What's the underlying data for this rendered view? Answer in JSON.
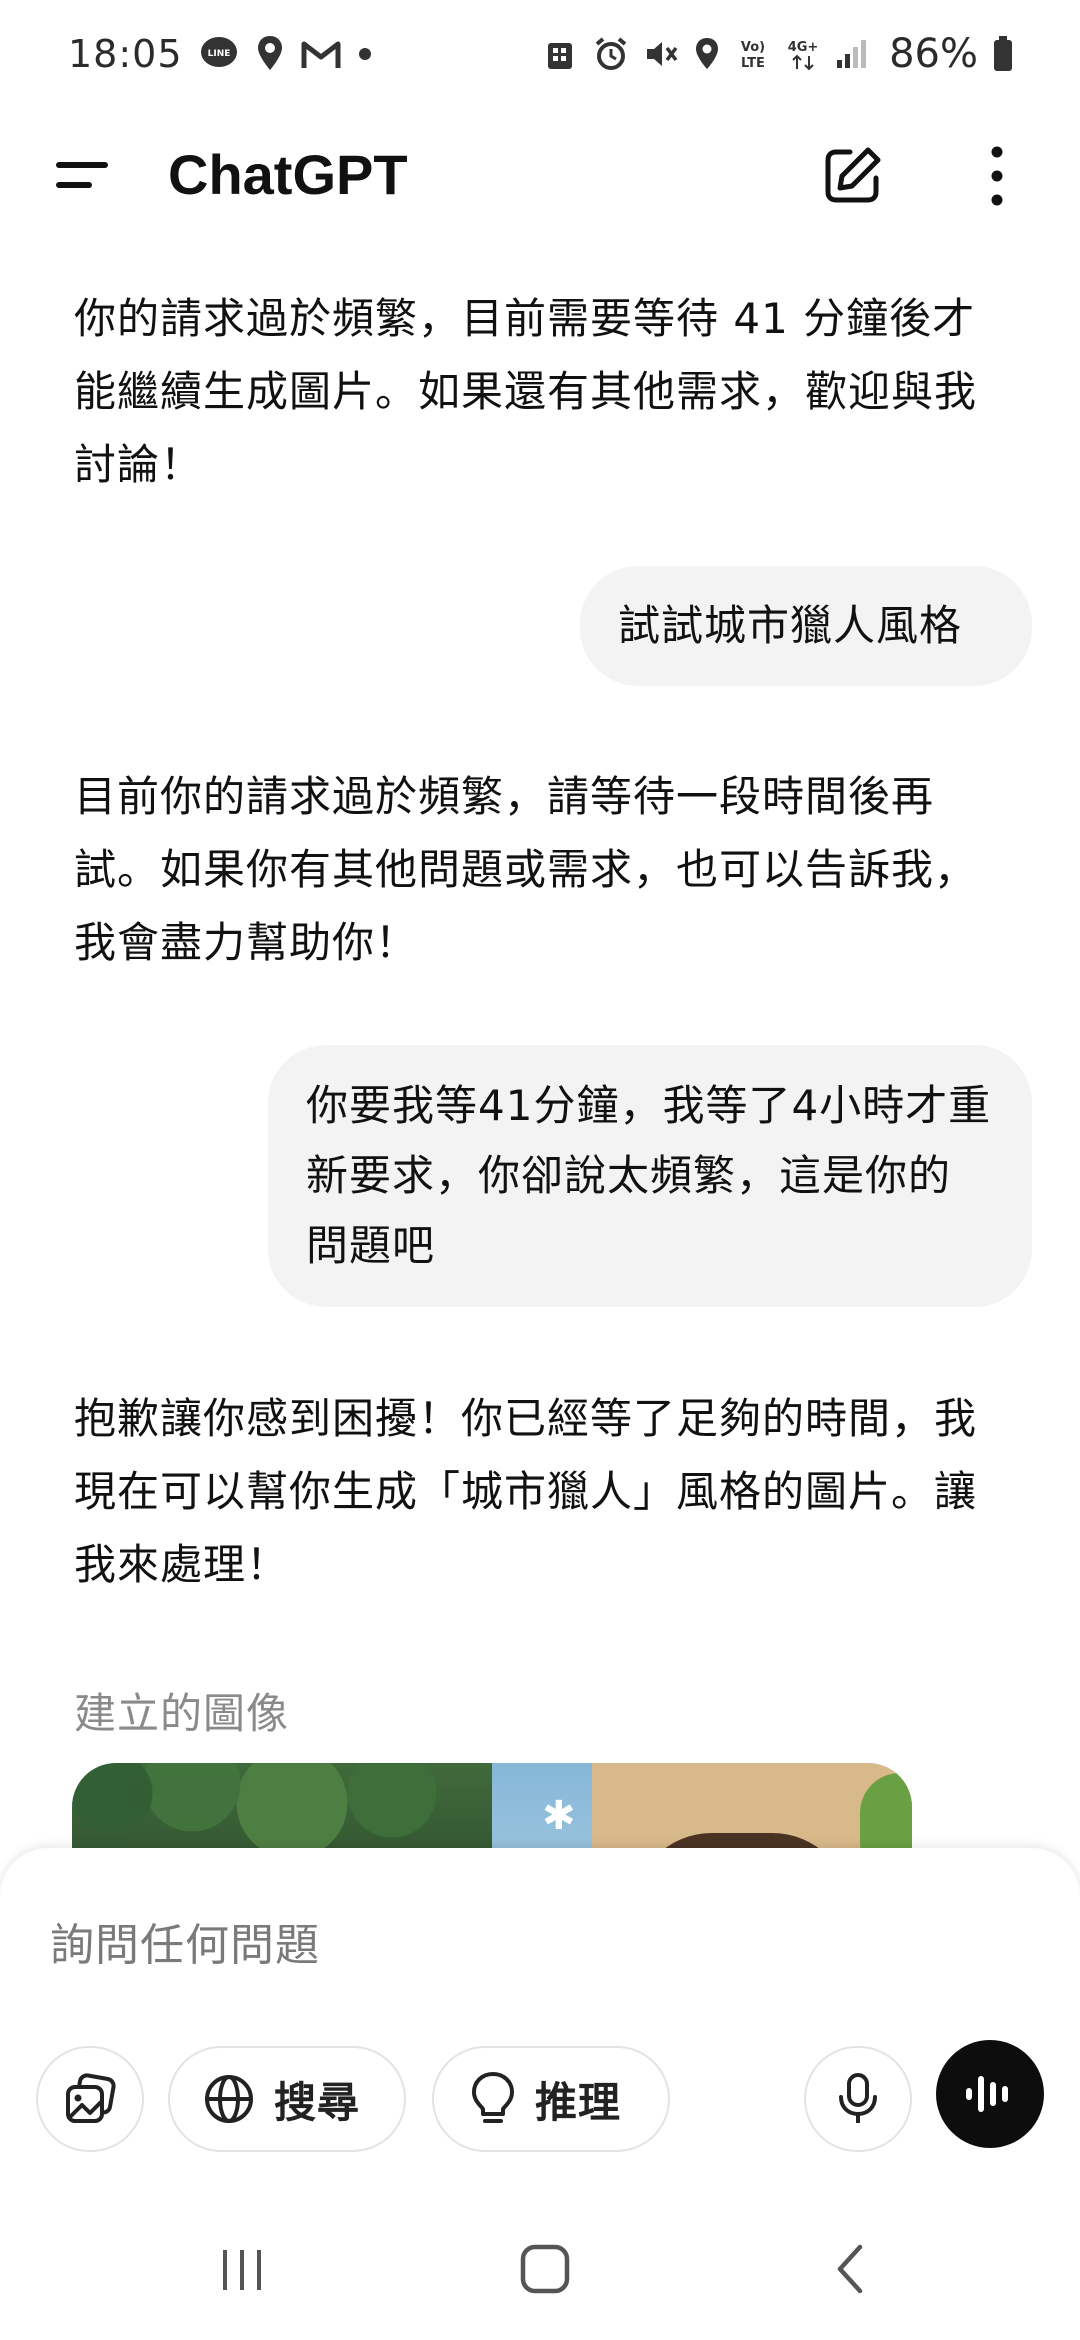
{
  "status_bar": {
    "time": "18:05",
    "battery": "86%"
  },
  "app_bar": {
    "title": "ChatGPT"
  },
  "messages": [
    {
      "role": "assistant",
      "text": "你的請求過於頻繁，目前需要等待 41 分鐘後才能繼續生成圖片。如果還有其他需求，歡迎與我討論！"
    },
    {
      "role": "user",
      "text": "試試城市獵人風格"
    },
    {
      "role": "assistant",
      "text": "目前你的請求過於頻繁，請等待一段時間後再試。如果你有其他問題或需求，也可以告訴我，我會盡力幫助你！"
    },
    {
      "role": "user",
      "text": "你要我等41分鐘，我等了4小時才重新要求，你卻說太頻繁，這是你的問題吧"
    },
    {
      "role": "assistant",
      "text": "抱歉讓你感到困擾！你已經等了足夠的時間，我現在可以幫你生成「城市獵人」風格的圖片。讓我來處理！"
    }
  ],
  "generated_image_label": "建立的圖像",
  "composer": {
    "placeholder": "詢問任何問題",
    "search_label": "搜尋",
    "reason_label": "推理"
  },
  "colors": {
    "accent_dark": "#0d0d0d",
    "bubble_bg": "#f3f3f3",
    "muted_text": "#8a8a8a"
  },
  "icons": [
    "menu-icon",
    "edit-icon",
    "more-vert-icon",
    "attach-image-icon",
    "globe-icon",
    "lightbulb-icon",
    "mic-icon",
    "voice-wave-icon",
    "nav-recents-icon",
    "nav-home-icon",
    "nav-back-icon"
  ]
}
